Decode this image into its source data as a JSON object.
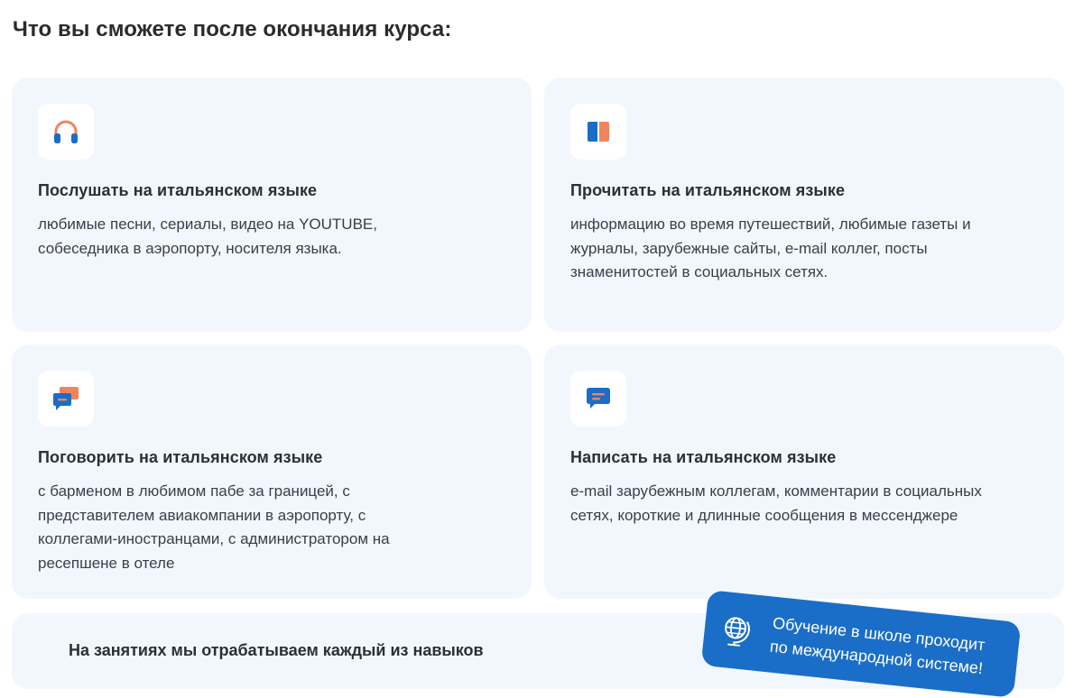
{
  "page": {
    "title": "Что вы сможете после окончания курса:"
  },
  "cards": [
    {
      "icon": "headphones-icon",
      "title": "Послушать на итальянском языке",
      "text": "любимые песни, сериалы, видео на YOUTUBE, собеседника в аэропорту, носителя языка."
    },
    {
      "icon": "book-icon",
      "title": "Прочитать на итальянском языке",
      "text": "информацию во время путешествий, любимые газеты и журналы, зарубежные сайты, e-mail коллег, посты знаменитостей в социальных сетях."
    },
    {
      "icon": "chat-bubbles-icon",
      "title": "Поговорить на итальянском языке",
      "text": "с барменом в любимом пабе за границей, с представителем авиакомпании в аэропорту, с коллегами-иностранцами, с администратором на ресепшене в отеле"
    },
    {
      "icon": "message-icon",
      "title": "Написать на итальянском языке",
      "text": "e-mail зарубежным коллегам, комментарии в социальных сетях, короткие и длинные сообщения в мессенджере"
    }
  ],
  "bottom": {
    "text": "На занятиях мы отрабатываем каждый из навыков"
  },
  "badge": {
    "icon": "globe-icon",
    "line1": "Обучение в школе проходит",
    "line2": "по международной системе!"
  },
  "colors": {
    "card_bg": "#f2f7fd",
    "accent_blue": "#1a6ec7",
    "accent_orange": "#f0845f"
  }
}
